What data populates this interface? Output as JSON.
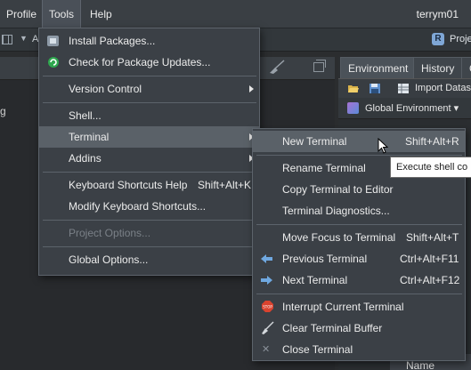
{
  "menubar": {
    "items": [
      "Profile",
      "Tools",
      "Help"
    ],
    "username": "terrym01"
  },
  "toolbar": {
    "letter": "A",
    "project_label": "Proje"
  },
  "left_pane": {
    "fragment": "g"
  },
  "right_pane": {
    "tabs": [
      "Environment",
      "History",
      "C"
    ],
    "import_label": "Import Datas",
    "env_label": "Global Environment ▾",
    "column_name": "Name"
  },
  "tools_menu": {
    "items": [
      {
        "label": "Install Packages...",
        "icon": "install-packages-icon"
      },
      {
        "label": "Check for Package Updates...",
        "icon": "refresh-icon"
      },
      {
        "label": "Version Control",
        "submenu": true
      },
      {
        "label": "Shell..."
      },
      {
        "label": "Terminal",
        "submenu": true
      },
      {
        "label": "Addins",
        "submenu": true
      },
      {
        "label": "Keyboard Shortcuts Help",
        "shortcut": "Shift+Alt+K"
      },
      {
        "label": "Modify Keyboard Shortcuts..."
      },
      {
        "label": "Project Options...",
        "disabled": true
      },
      {
        "label": "Global Options..."
      }
    ]
  },
  "terminal_menu": {
    "items": [
      {
        "label": "New Terminal",
        "shortcut": "Shift+Alt+R"
      },
      {
        "label": "Rename Terminal"
      },
      {
        "label": "Copy Terminal to Editor"
      },
      {
        "label": "Terminal Diagnostics..."
      },
      {
        "label": "Move Focus to Terminal",
        "shortcut": "Shift+Alt+T"
      },
      {
        "label": "Previous Terminal",
        "shortcut": "Ctrl+Alt+F11",
        "icon": "left-arrow-icon"
      },
      {
        "label": "Next Terminal",
        "shortcut": "Ctrl+Alt+F12",
        "icon": "right-arrow-icon"
      },
      {
        "label": "Interrupt Current Terminal",
        "icon": "stop-icon"
      },
      {
        "label": "Clear Terminal Buffer",
        "icon": "broom-icon"
      },
      {
        "label": "Close Terminal",
        "icon": "close-icon"
      }
    ]
  },
  "tooltip": {
    "text": "Execute shell co"
  },
  "colors": {
    "menu_bg": "#3b4046",
    "highlight": "#5a6168",
    "stop": "#d9432f",
    "arrow": "#6fa8e0"
  }
}
